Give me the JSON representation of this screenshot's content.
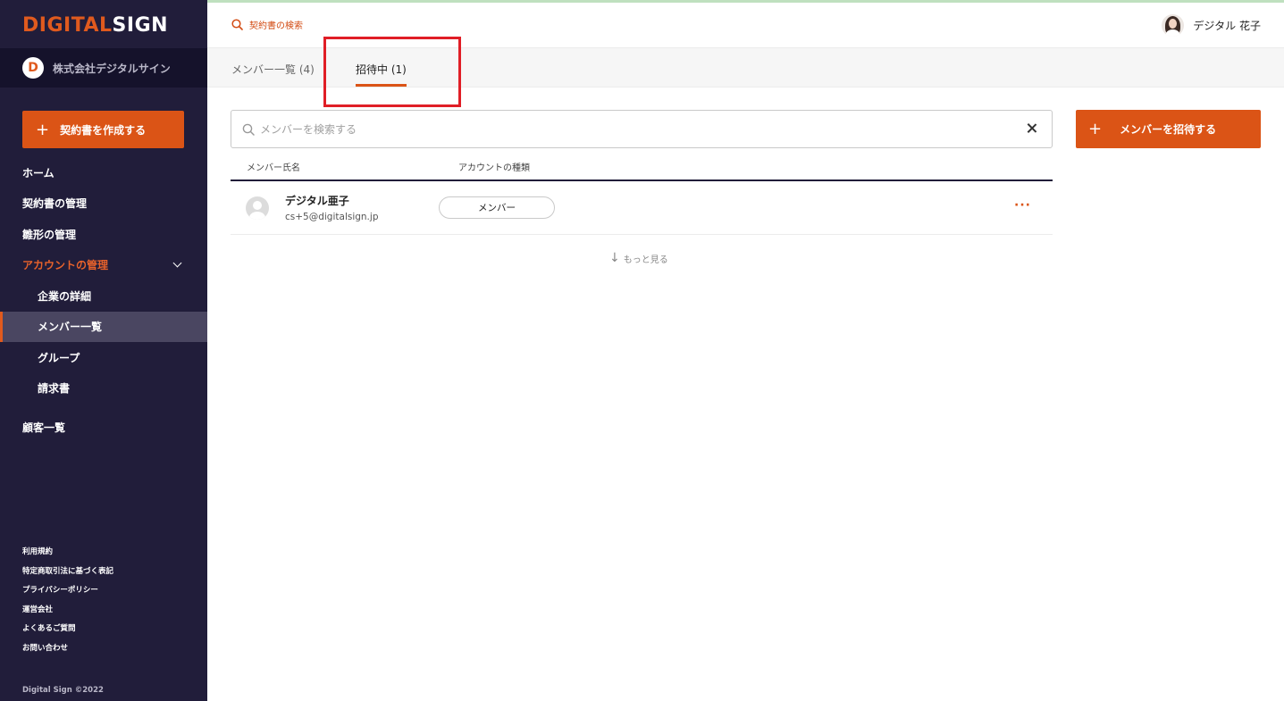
{
  "sidebar": {
    "logo_part1": "DIGITAL",
    "logo_part2": "SIGN",
    "company_initial": "D",
    "company_name": "株式会社デジタルサイン",
    "create_button": "契約書を作成する",
    "nav": {
      "home": "ホーム",
      "contracts": "契約書の管理",
      "templates": "雛形の管理",
      "account": "アカウントの管理",
      "company_details": "企業の詳細",
      "members": "メンバー一覧",
      "groups": "グループ",
      "invoices": "請求書",
      "customers": "顧客一覧"
    },
    "footer_links": [
      "利用規約",
      "特定商取引法に基づく表記",
      "プライバシーポリシー",
      "運営会社",
      "よくあるご質問",
      "お問い合わせ"
    ],
    "copyright": "Digital Sign ©2022"
  },
  "header": {
    "search_contract": "契約書の検索",
    "user_name": "デジタル 花子"
  },
  "tabs": [
    {
      "label": "メンバー一覧 (4)"
    },
    {
      "label": "招待中 (1)"
    }
  ],
  "search": {
    "placeholder": "メンバーを検索する"
  },
  "invite_button": "メンバーを招待する",
  "table": {
    "headers": [
      "メンバー氏名",
      "アカウントの種類"
    ],
    "rows": [
      {
        "name": "デジタル亜子",
        "email": "cs+5@digitalsign.jp",
        "role": "メンバー",
        "actions": "···"
      }
    ]
  },
  "load_more": "もっと見る",
  "colors": {
    "accent": "#db5416",
    "sidebar_bg": "#211d3a",
    "highlight": "#e01e26"
  }
}
